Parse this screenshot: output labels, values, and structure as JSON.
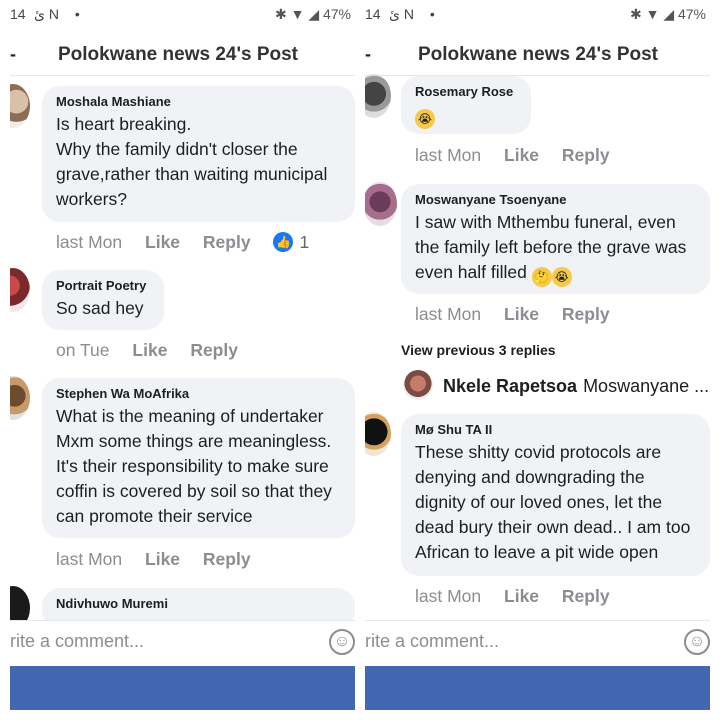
{
  "left": {
    "status": {
      "time": "14",
      "icons": "ئ N •",
      "right": "✱ ▼ ◢ 47%"
    },
    "header": {
      "title": "Polokwane news 24's Post",
      "back": "-"
    },
    "comments": [
      {
        "name": "Moshala Mashiane",
        "text": "Is heart breaking. \nWhy the family didn't closer the grave,rather than waiting municipal workers?",
        "time": "last Mon",
        "like": "Like",
        "reply": "Reply",
        "reactions": "1"
      },
      {
        "name": "Portrait Poetry",
        "text": "So sad hey",
        "time": "on Tue",
        "like": "Like",
        "reply": "Reply"
      },
      {
        "name": "Stephen Wa MoAfrika",
        "text": "What is the meaning of undertaker Mxm some things are meaningless. It's their responsibility to make sure coffin is covered by soil so that they can promote their service",
        "time": "last Mon",
        "like": "Like",
        "reply": "Reply"
      },
      {
        "name": "Ndivhuwo Muremi"
      }
    ],
    "composer": {
      "placeholder": "rite a comment..."
    }
  },
  "right": {
    "status": {
      "time": "14",
      "icons": "ئ N •",
      "right": "✱ ▼ ◢ 47%"
    },
    "header": {
      "title": "Polokwane news 24's Post",
      "back": "-"
    },
    "comments": [
      {
        "name": "Rosemary Rose",
        "time": "last Mon",
        "like": "Like",
        "reply": "Reply"
      },
      {
        "name": "Moswanyane Tsoenyane",
        "text": "I saw with Mthembu funeral, even the family left before the grave was even half filled",
        "time": "last Mon",
        "like": "Like",
        "reply": "Reply"
      },
      {
        "name": "Mø Shu TA II",
        "text": "These shitty covid protocols are denying and downgrading the dignity of our loved ones, let the dead bury their own dead.. I am too African to leave a pit wide open",
        "time": "last Mon",
        "like": "Like",
        "reply": "Reply"
      }
    ],
    "view_previous": "View previous 3 replies",
    "inline_reply": {
      "name": "Nkele Rapetsoa",
      "mention": "Moswanyane ..."
    },
    "composer": {
      "placeholder": "rite a comment..."
    }
  },
  "colors": {
    "accent": "#1877f2",
    "bottombar": "#4267b2",
    "bubble": "#f0f2f5",
    "meta": "#8a8d91"
  }
}
